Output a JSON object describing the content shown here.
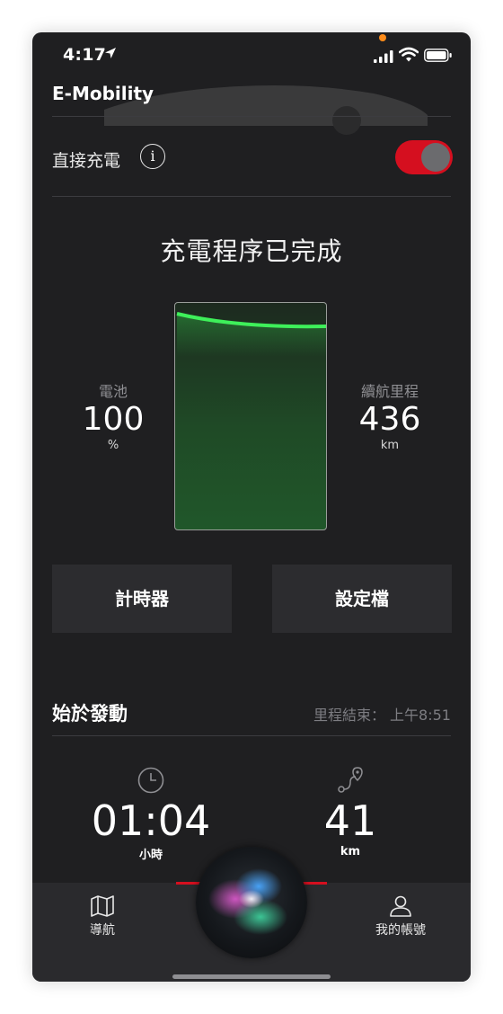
{
  "status_bar": {
    "time": "4:17"
  },
  "header": {
    "title": "E-Mobility"
  },
  "direct_charging": {
    "label": "直接充電",
    "info_icon": "info-icon",
    "toggle_on": true,
    "toggle_color": "#d50f1f"
  },
  "charging": {
    "status_text": "充電程序已完成",
    "battery": {
      "label": "電池",
      "value": "100",
      "unit": "%"
    },
    "range": {
      "label": "續航里程",
      "value": "436",
      "unit": "km"
    },
    "fill_color": "#2fe04a"
  },
  "buttons": {
    "timer": "計時器",
    "profile": "設定檔"
  },
  "trip": {
    "title": "始於發動",
    "ended": "里程結束： 上午8:51",
    "duration": {
      "value": "01:04",
      "unit": "小時",
      "icon": "clock-icon"
    },
    "distance": {
      "value": "41",
      "unit": "km",
      "icon": "route-icon"
    }
  },
  "tabs": [
    {
      "label": "導航",
      "icon": "map-icon"
    },
    {
      "label": "我的帳號",
      "icon": "user-icon"
    }
  ],
  "colors": {
    "accent_red": "#d50f1f",
    "background": "#1f1f21"
  }
}
